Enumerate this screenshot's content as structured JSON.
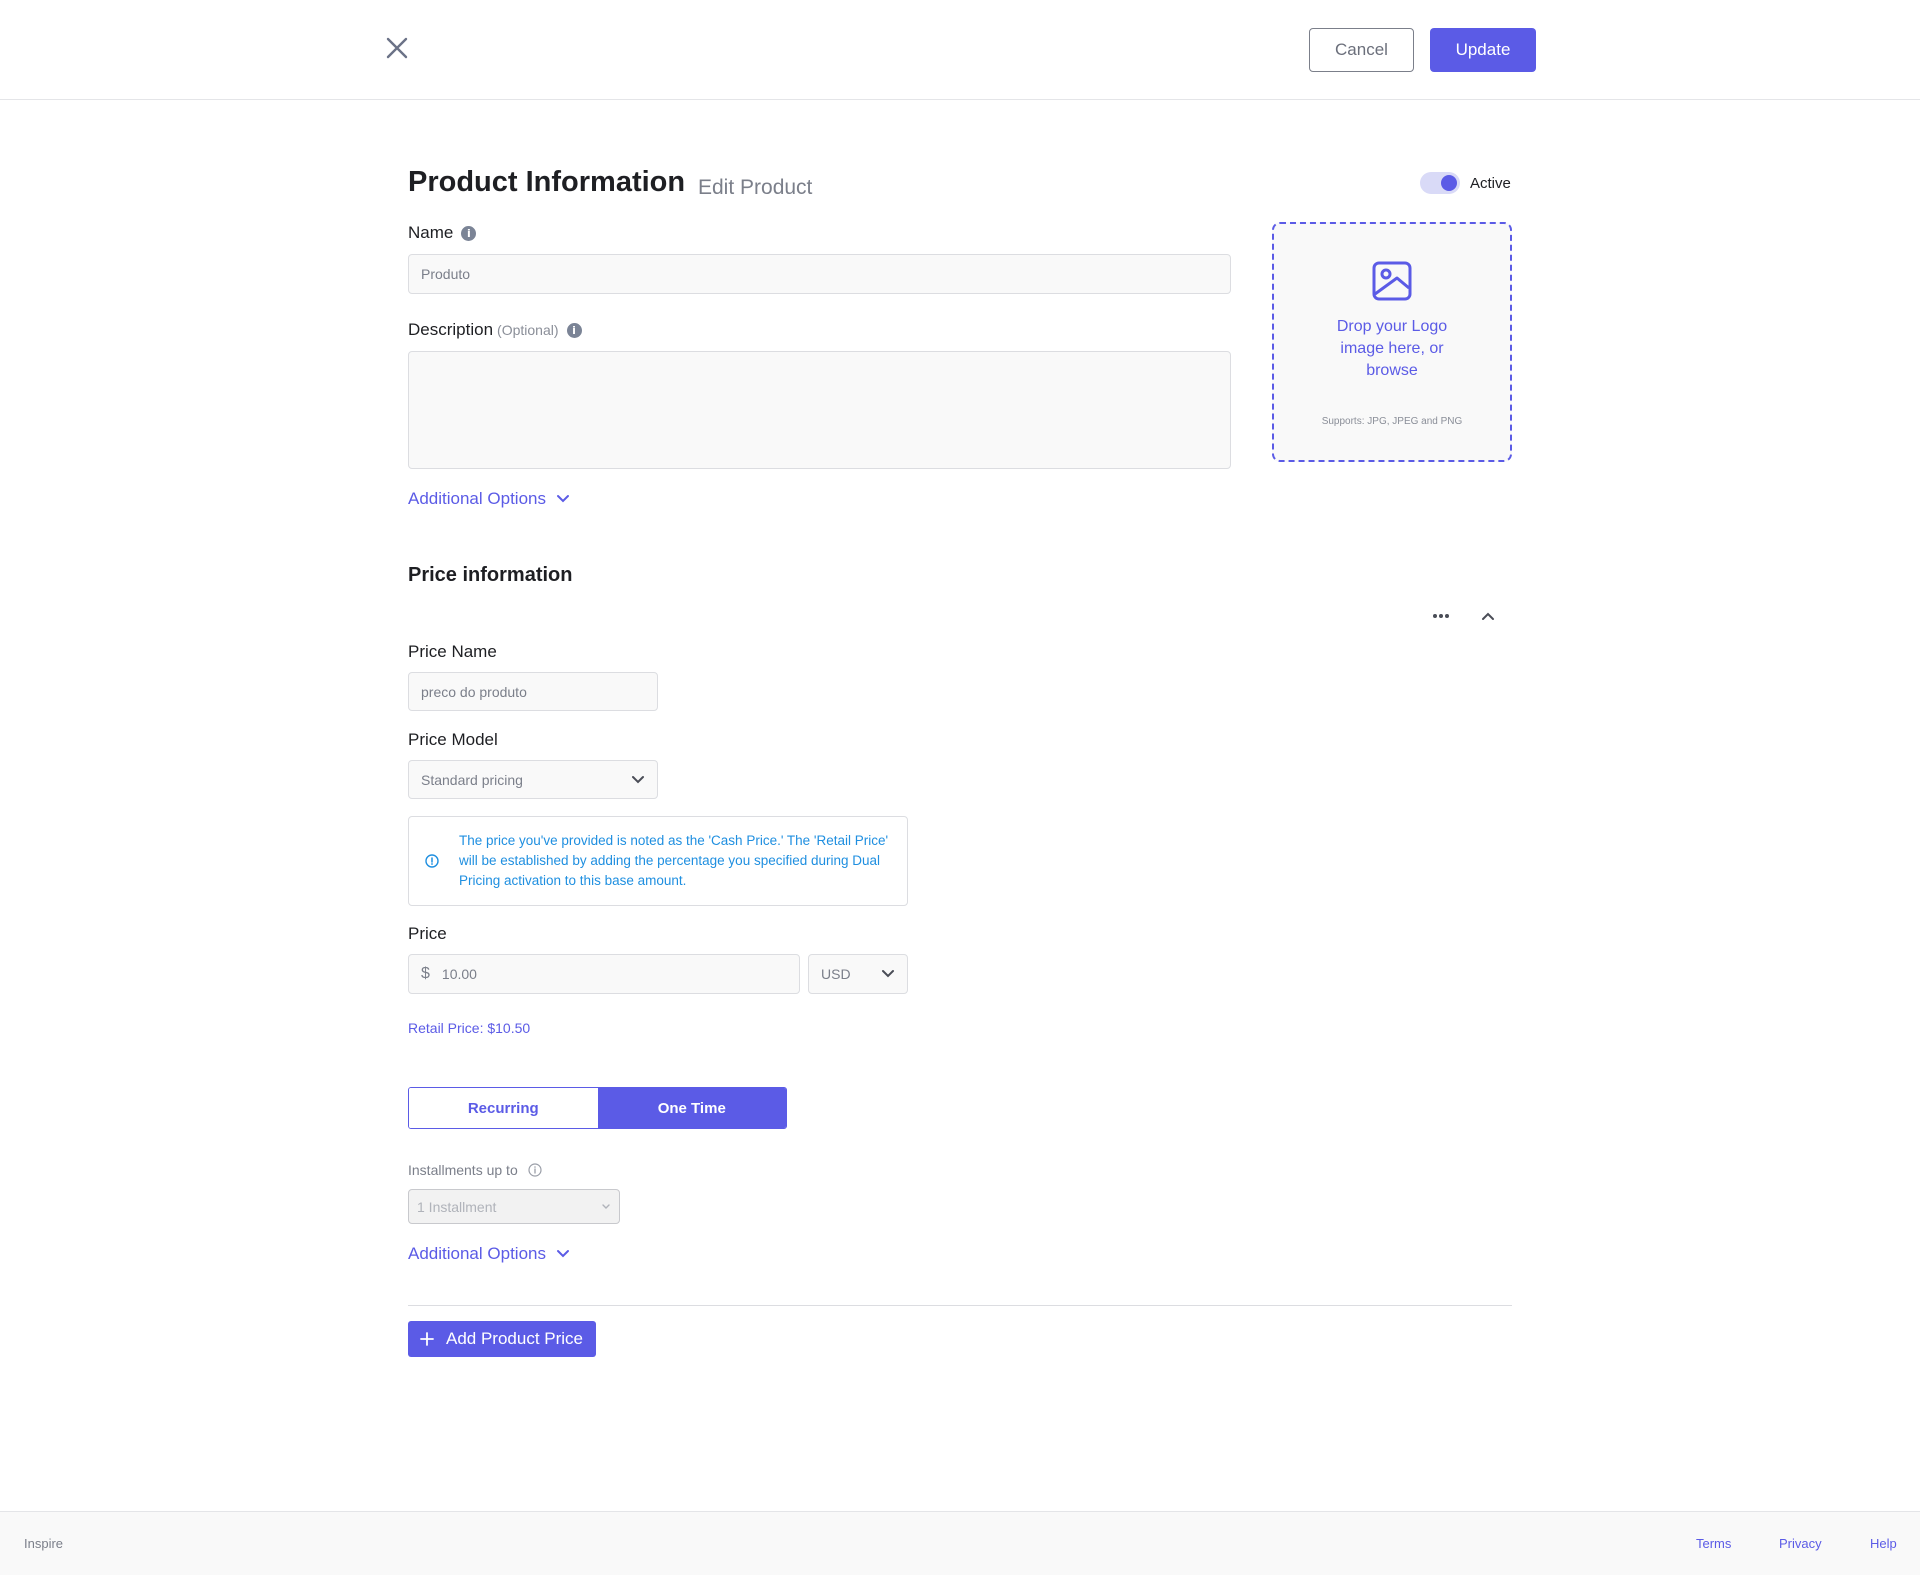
{
  "header": {
    "cancel_label": "Cancel",
    "update_label": "Update"
  },
  "product": {
    "title": "Product Information",
    "subtitle": "Edit Product",
    "status_label": "Active",
    "status_active": true,
    "name_label": "Name",
    "name_value": "Produto",
    "description_label": "Description",
    "description_optional": "(Optional)",
    "description_value": "",
    "additional_options": "Additional Options"
  },
  "dropzone": {
    "text": "Drop your Logo image here, or browse",
    "supports": "Supports: JPG, JPEG and PNG"
  },
  "price": {
    "section_title": "Price information",
    "price_name_label": "Price Name",
    "price_name_value": "preco do produto",
    "price_model_label": "Price Model",
    "price_model_value": "Standard pricing",
    "notice": "The price you've provided is noted as the 'Cash Price.' The 'Retail Price' will be established by adding the percentage you specified during Dual Pricing activation to this base amount.",
    "price_label": "Price",
    "currency_symbol": "$",
    "amount": "10.00",
    "currency": "USD",
    "retail_price": "Retail Price: $10.50",
    "billing_options": [
      "Recurring",
      "One Time"
    ],
    "billing_selected": "One Time",
    "installments_label": "Installments up to",
    "installments_value": "1 Installment",
    "additional_options": "Additional Options",
    "add_price_label": "Add Product Price"
  },
  "footer": {
    "brand": "Inspire",
    "links": [
      "Terms",
      "Privacy",
      "Help"
    ]
  },
  "colors": {
    "accent": "#5b5be6",
    "notice_text": "#1f8fe0"
  }
}
